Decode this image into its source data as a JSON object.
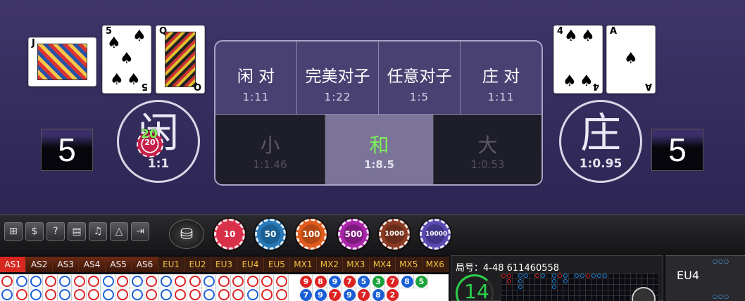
{
  "player": {
    "label": "闲",
    "score": "5",
    "odds": "1:1",
    "cards": [
      {
        "rank": "J",
        "suit": "♦",
        "face": true
      },
      {
        "rank": "5",
        "suit": "♠",
        "face": false
      },
      {
        "rank": "Q",
        "suit": "♣",
        "face": true
      }
    ],
    "bet_chip_amount": "20",
    "bet_chip_underlay": "20"
  },
  "banker": {
    "label": "庄",
    "score": "5",
    "odds": "1:0.95",
    "cards": [
      {
        "rank": "4",
        "suit": "♠",
        "face": false
      },
      {
        "rank": "A",
        "suit": "♠",
        "face": false
      }
    ]
  },
  "side_bets": [
    {
      "label": "闲 对",
      "odds": "1:11"
    },
    {
      "label": "完美对子",
      "odds": "1:22"
    },
    {
      "label": "任意对子",
      "odds": "1:5"
    },
    {
      "label": "庄 对",
      "odds": "1:11"
    }
  ],
  "main_bets": [
    {
      "label": "小",
      "odds": "1:1.46"
    },
    {
      "label": "和",
      "odds": "1:8.5"
    },
    {
      "label": "大",
      "odds": "1:0.53"
    }
  ],
  "toolbar": {
    "tools": [
      {
        "icon": "table-icon",
        "glyph": "⊞"
      },
      {
        "icon": "currency-icon",
        "glyph": "$"
      },
      {
        "icon": "help-icon",
        "glyph": "?"
      },
      {
        "icon": "history-icon",
        "glyph": "▤"
      },
      {
        "icon": "music-icon",
        "glyph": "♫"
      },
      {
        "icon": "warning-icon",
        "glyph": "△"
      },
      {
        "icon": "exit-icon",
        "glyph": "⇥"
      }
    ],
    "stack_glyph": "⛁",
    "chips": [
      {
        "value": "10",
        "color": "#d9304a"
      },
      {
        "value": "50",
        "color": "#2778b6"
      },
      {
        "value": "100",
        "color": "#e05a1c"
      },
      {
        "value": "500",
        "color": "#a824a8"
      },
      {
        "value": "1000",
        "color": "#8a3a22"
      },
      {
        "value": "10000",
        "color": "#5a4ab0"
      }
    ]
  },
  "table_tabs": [
    "AS1",
    "AS2",
    "AS3",
    "AS4",
    "AS5",
    "AS6",
    "EU1",
    "EU2",
    "EU3",
    "EU4",
    "EU5",
    "MX1",
    "MX2",
    "MX3",
    "MX4",
    "MX5",
    "MX6"
  ],
  "active_tab": "AS1",
  "road_circles": [
    "r",
    "b",
    "b",
    "r",
    "b",
    "r",
    "r",
    "b",
    "r",
    "b",
    "r",
    "b",
    "r",
    "r",
    "b",
    "r",
    "r",
    "r",
    "r",
    "r"
  ],
  "road_row2": [
    "b",
    "r",
    "b",
    "r",
    "b",
    "r",
    "r",
    "b",
    "r",
    "b",
    "r",
    "b",
    "r",
    "r",
    "b",
    "r",
    "r",
    "b",
    "r",
    "r"
  ],
  "road_numbers_top": [
    {
      "n": "9",
      "c": "r"
    },
    {
      "n": "8",
      "c": "r"
    },
    {
      "n": "9",
      "c": "b"
    },
    {
      "n": "7",
      "c": "r"
    },
    {
      "n": "5",
      "c": "b"
    },
    {
      "n": "3",
      "c": "g"
    },
    {
      "n": "7",
      "c": "r"
    },
    {
      "n": "8",
      "c": "b"
    },
    {
      "n": "5",
      "c": "g"
    }
  ],
  "road_numbers_bottom": [
    {
      "n": "7",
      "c": "b"
    },
    {
      "n": "9",
      "c": "b"
    },
    {
      "n": "7",
      "c": "r"
    },
    {
      "n": "9",
      "c": "b"
    },
    {
      "n": "7",
      "c": "r"
    },
    {
      "n": "8",
      "c": "b"
    },
    {
      "n": "2",
      "c": "r"
    }
  ],
  "info": {
    "round_label": "局号：4-48 611460558",
    "timer": "14"
  },
  "side_panel": {
    "table_name": "EU4",
    "dots": "○○○",
    "dots2": "○○○"
  }
}
